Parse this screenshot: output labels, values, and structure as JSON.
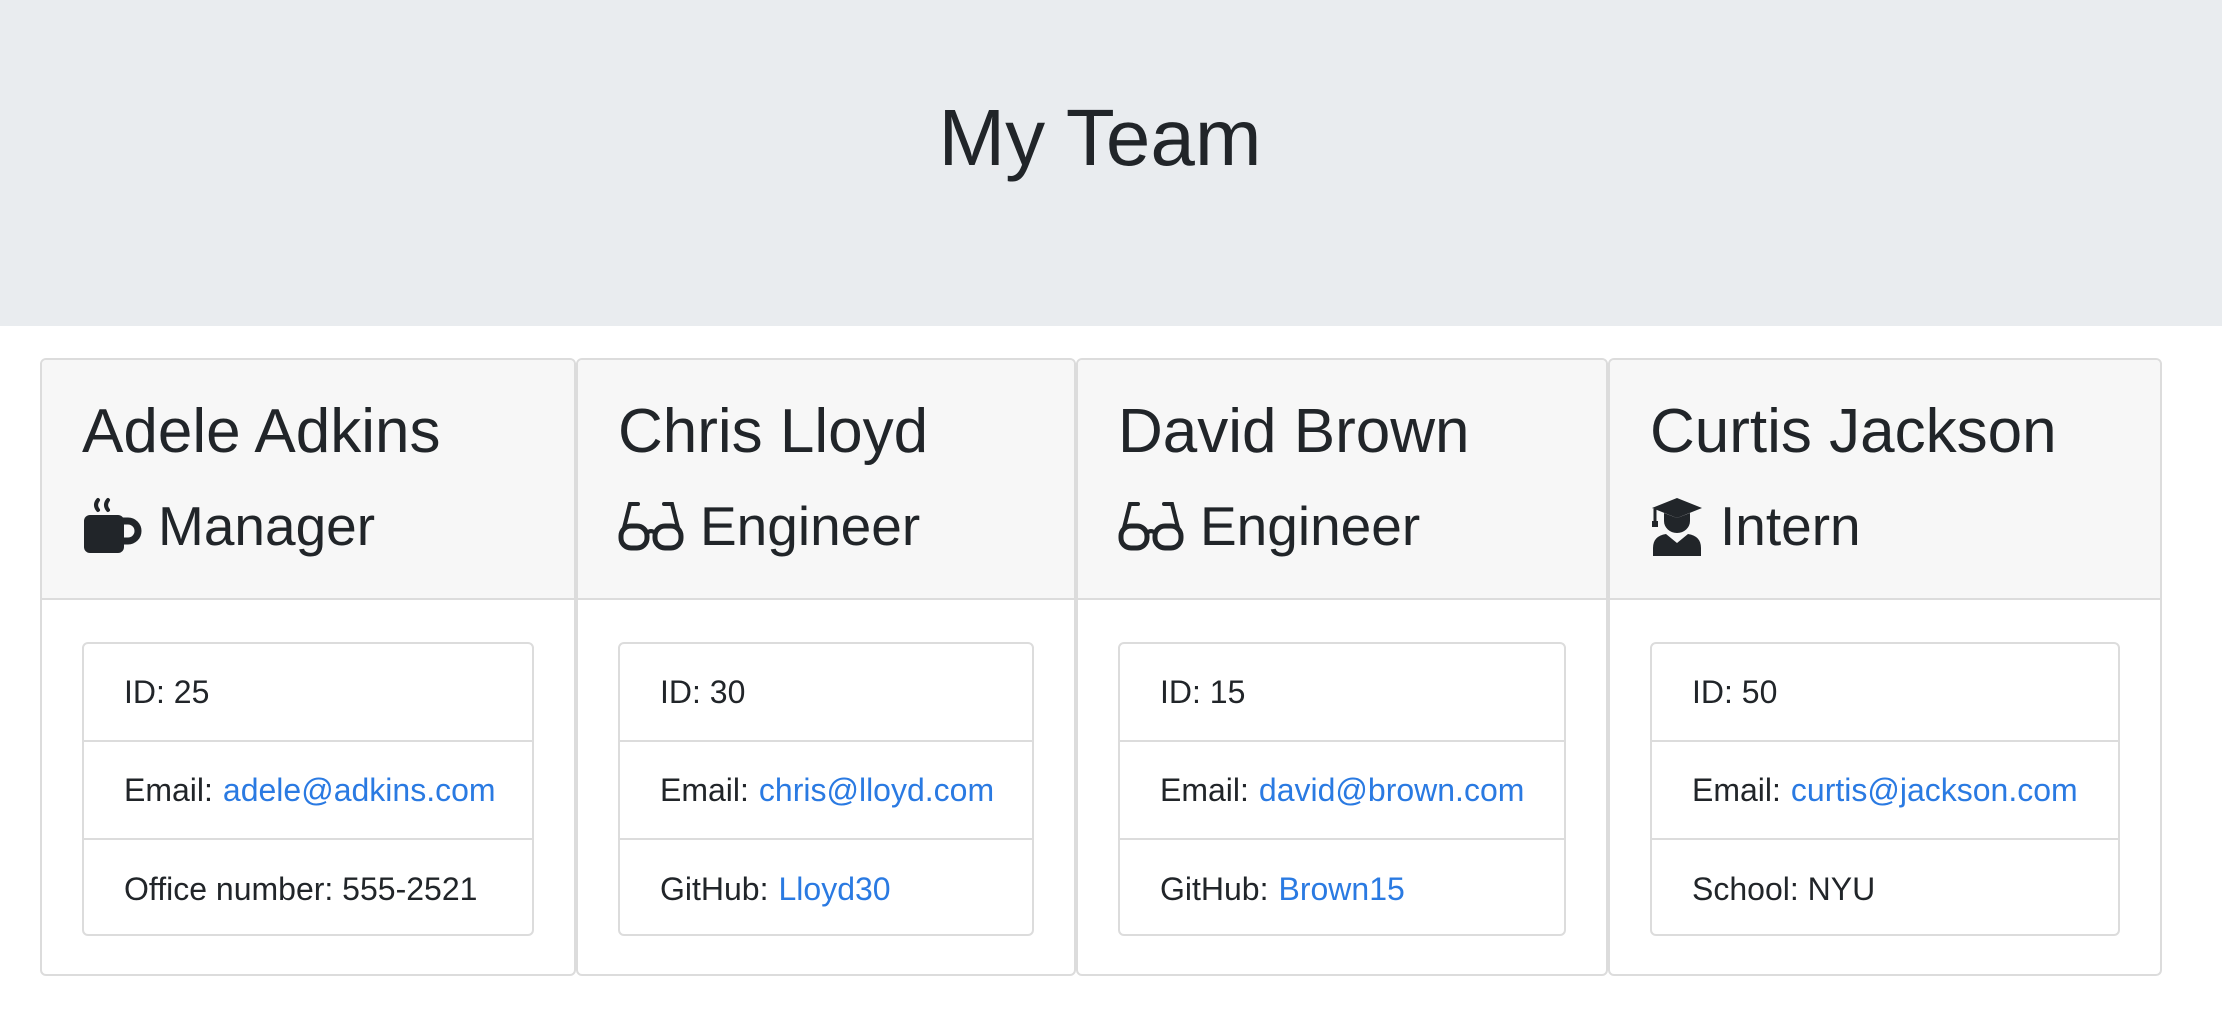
{
  "header": {
    "title": "My Team"
  },
  "colors": {
    "jumbotron_bg": "#e9ecef",
    "link": "#2a7ae2",
    "text": "#212529",
    "card_header_bg": "#f7f7f7"
  },
  "team": [
    {
      "name": "Adele Adkins",
      "role": "Manager",
      "role_icon": "mug-icon",
      "id_label": "ID: 25",
      "email_label": "Email:",
      "email": "adele@adkins.com",
      "extra_label": "Office number: 555-2521",
      "extra_link": ""
    },
    {
      "name": "Chris Lloyd",
      "role": "Engineer",
      "role_icon": "glasses-icon",
      "id_label": "ID: 30",
      "email_label": "Email:",
      "email": "chris@lloyd.com",
      "extra_label": "GitHub:",
      "extra_link": "Lloyd30"
    },
    {
      "name": "David Brown",
      "role": "Engineer",
      "role_icon": "glasses-icon",
      "id_label": "ID: 15",
      "email_label": "Email:",
      "email": "david@brown.com",
      "extra_label": "GitHub:",
      "extra_link": "Brown15"
    },
    {
      "name": "Curtis Jackson",
      "role": "Intern",
      "role_icon": "graduate-icon",
      "id_label": "ID: 50",
      "email_label": "Email:",
      "email": "curtis@jackson.com",
      "extra_label": "School: NYU",
      "extra_link": ""
    }
  ]
}
